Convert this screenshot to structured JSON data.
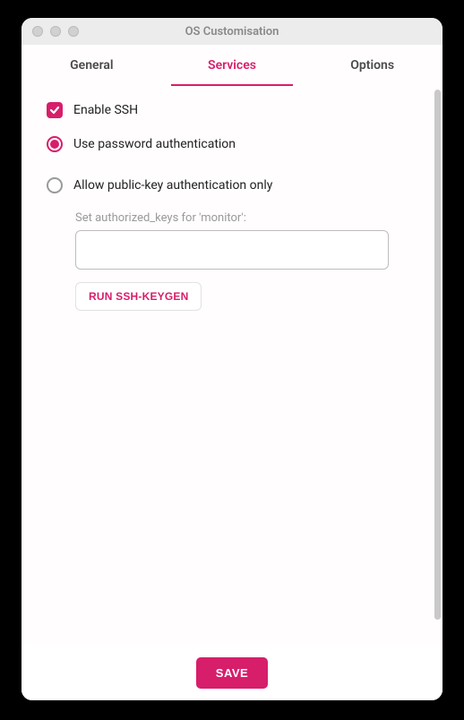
{
  "window": {
    "title": "OS Customisation"
  },
  "tabs": {
    "general": "General",
    "services": "Services",
    "options": "Options",
    "active": "services"
  },
  "ssh": {
    "enable_label": "Enable SSH",
    "enabled": true,
    "auth": {
      "password_label": "Use password authentication",
      "pubkey_label": "Allow public-key authentication only",
      "selected": "password"
    },
    "keys": {
      "label": "Set authorized_keys for 'monitor':",
      "value": "",
      "keygen_button": "RUN SSH-KEYGEN"
    }
  },
  "footer": {
    "save": "SAVE"
  }
}
